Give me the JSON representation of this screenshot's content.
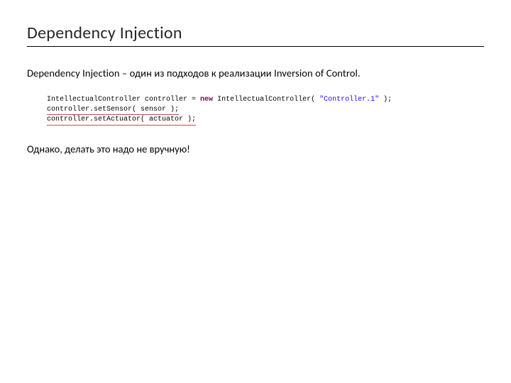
{
  "title": "Dependency Injection",
  "intro": "Dependency Injection – один из подходов к реализации Inversion of Control.",
  "code": {
    "line1_pre": "IntellectualController controller = ",
    "line1_kw": "new",
    "line1_post": " IntellectualController( ",
    "line1_str": "\"Controller.1\"",
    "line1_end": " );",
    "line2": "controller.setSensor( sensor );",
    "line3": "controller.setActuator( actuator );"
  },
  "note": "Однако, делать это надо не вручную!"
}
